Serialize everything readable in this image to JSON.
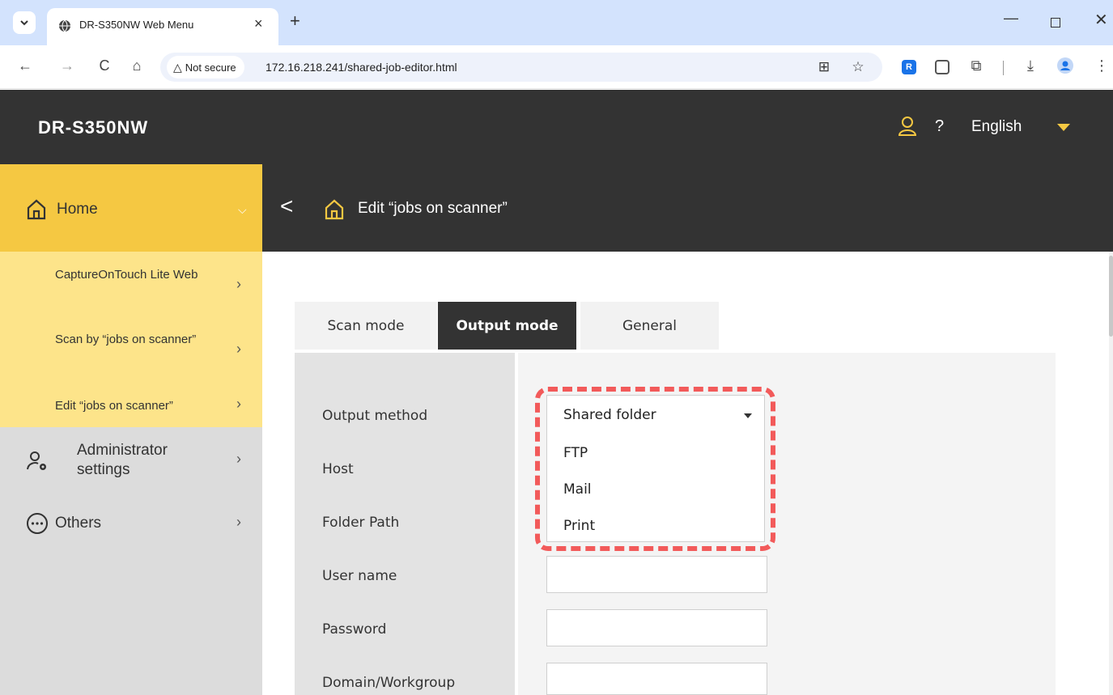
{
  "browser": {
    "tab_title": "DR-S350NW Web Menu",
    "tab_close": "×",
    "new_tab": "+",
    "not_secure": "Not secure",
    "url": "172.16.218.241/shared-job-editor.html",
    "ext_r": "R"
  },
  "header": {
    "brand": "DR-S350NW",
    "help": "?",
    "language": "English",
    "accent_color": "#f5c842",
    "dark_color": "#333333"
  },
  "sidebar": {
    "home": "Home",
    "subitems": [
      "CaptureOnTouch Lite Web",
      "Scan by “jobs on scanner”",
      "Edit “jobs on scanner”"
    ],
    "admin": "Administrator settings",
    "others": "Others"
  },
  "page": {
    "back": "<",
    "title": "Edit “jobs on scanner”"
  },
  "tabs": [
    "Scan mode",
    "Output mode",
    "General"
  ],
  "active_tab": "Output mode",
  "form": {
    "labels": [
      "Output method",
      "Host",
      "Folder Path",
      "User name",
      "Password",
      "Domain/Workgroup"
    ],
    "output_method": {
      "selected": "Shared folder",
      "options": [
        "FTP",
        "Mail",
        "Print"
      ]
    }
  }
}
